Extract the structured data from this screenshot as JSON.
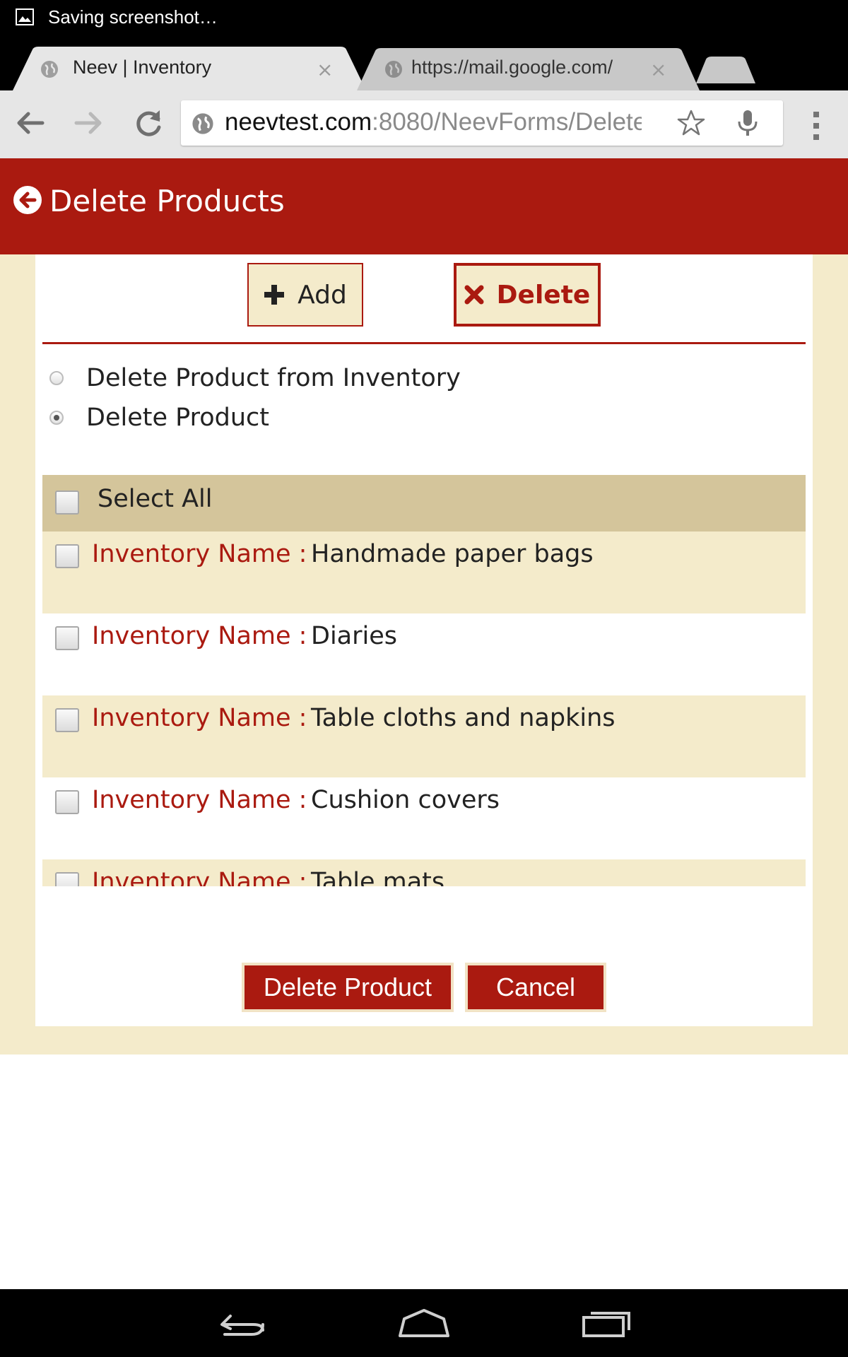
{
  "status_bar": {
    "notification_text": "Saving screenshot…",
    "icon": "image-icon"
  },
  "browser": {
    "tabs": [
      {
        "title": "Neev | Inventory",
        "active": true,
        "close": "×"
      },
      {
        "title": "https://mail.google.com/",
        "active": false,
        "close": "×"
      }
    ],
    "url": {
      "host": "neevtest.com",
      "rest": ":8080/NeevForms/Delete"
    }
  },
  "header": {
    "title": "Delete Products"
  },
  "mode_buttons": {
    "add_label": "Add",
    "delete_label": "Delete"
  },
  "options": [
    {
      "label": "Delete Product from Inventory",
      "selected": false
    },
    {
      "label": "Delete Product",
      "selected": true
    }
  ],
  "list": {
    "select_all_label": "Select All",
    "field_label": "Inventory Name :",
    "items": [
      {
        "name": "Handmade paper bags"
      },
      {
        "name": "Diaries"
      },
      {
        "name": "Table cloths and napkins"
      },
      {
        "name": "Cushion covers"
      },
      {
        "name": "Table mats"
      }
    ]
  },
  "actions": {
    "delete_product_label": "Delete Product",
    "cancel_label": "Cancel"
  },
  "colors": {
    "brand_red": "#aa1a10",
    "cream": "#f4ebcb",
    "tan": "#d4c59b"
  }
}
